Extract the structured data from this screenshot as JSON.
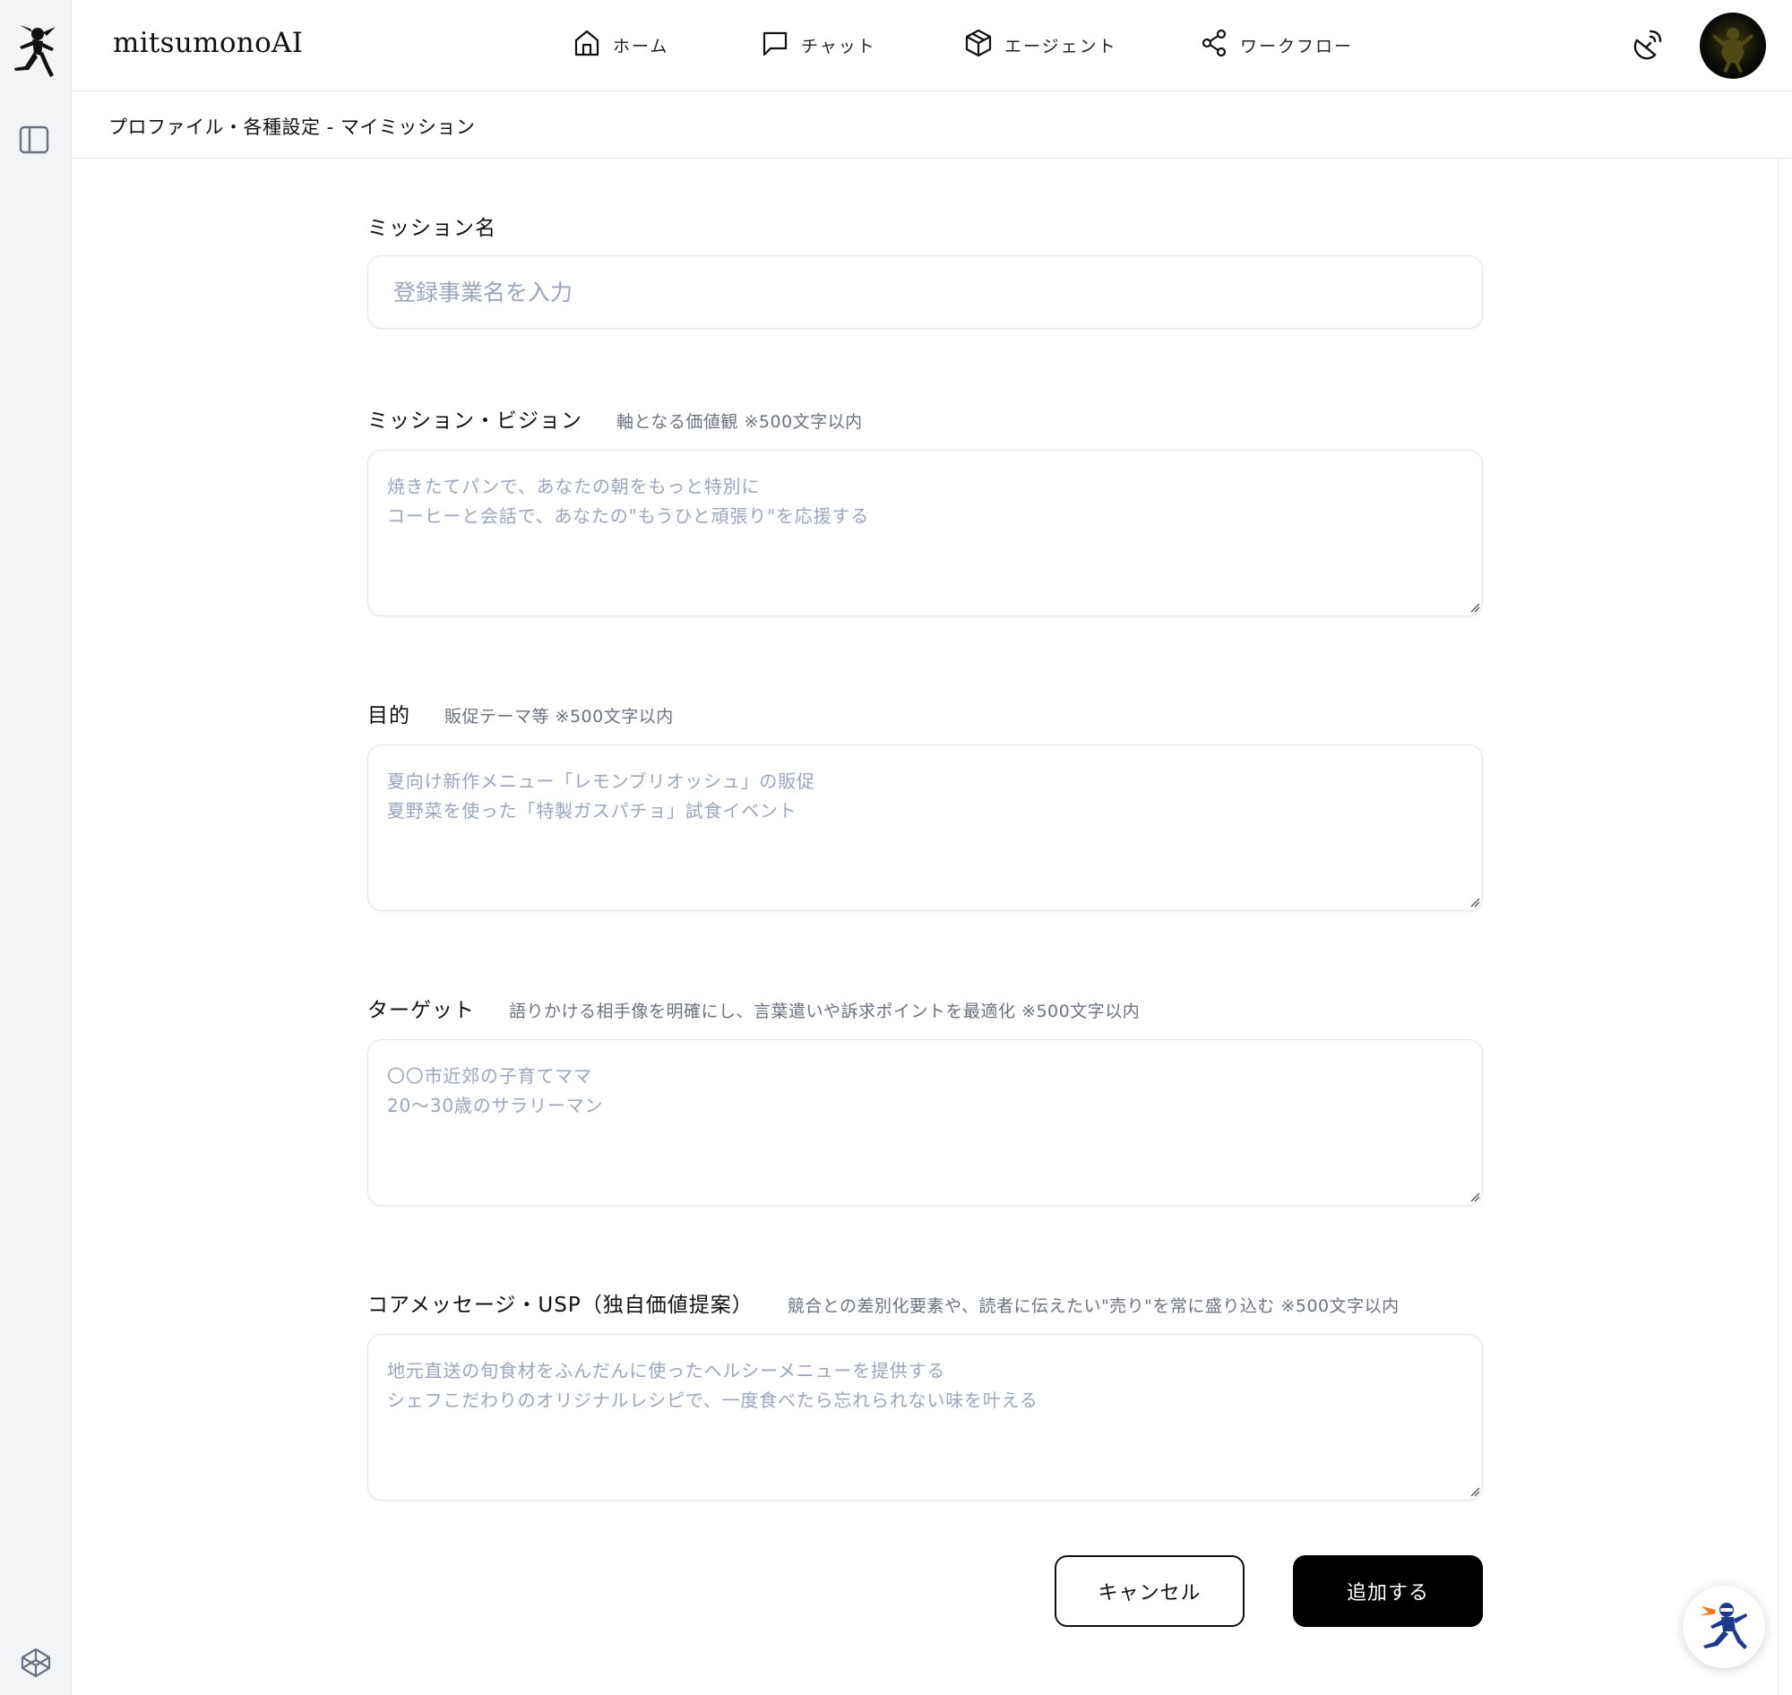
{
  "app": {
    "name": "mitsumonoAI"
  },
  "nav": {
    "items": [
      {
        "label": "ホーム",
        "icon": "home-icon"
      },
      {
        "label": "チャット",
        "icon": "chat-icon"
      },
      {
        "label": "エージェント",
        "icon": "box-icon"
      },
      {
        "label": "ワークフロー",
        "icon": "share-icon"
      }
    ]
  },
  "header_icons": [
    "satellite-icon",
    "avatar"
  ],
  "sidebar_icons": [
    "logo-ninja-icon",
    "panel-toggle-icon",
    "codepen-cube-icon"
  ],
  "breadcrumb": "プロファイル・各種設定 - マイミッション",
  "form": {
    "mission_name": {
      "label": "ミッション名",
      "value": "",
      "placeholder": "登録事業名を入力"
    },
    "vision": {
      "label": "ミッション・ビジョン",
      "hint": "軸となる価値観 ※500文字以内",
      "value": "",
      "placeholder": "焼きたてパンで、あなたの朝をもっと特別に\nコーヒーと会話で、あなたの\"もうひと頑張り\"を応援する"
    },
    "purpose": {
      "label": "目的",
      "hint": "販促テーマ等 ※500文字以内",
      "value": "",
      "placeholder": "夏向け新作メニュー「レモンブリオッシュ」の販促\n夏野菜を使った「特製ガスパチョ」試食イベント"
    },
    "target": {
      "label": "ターゲット",
      "hint": "語りかける相手像を明確にし、言葉遣いや訴求ポイントを最適化 ※500文字以内",
      "value": "",
      "placeholder": "〇〇市近郊の子育てママ\n20〜30歳のサラリーマン"
    },
    "usp": {
      "label": "コアメッセージ・USP（独自価値提案）",
      "hint": "競合との差別化要素や、読者に伝えたい\"売り\"を常に盛り込む ※500文字以内",
      "value": "",
      "placeholder": "地元直送の旬食材をふんだんに使ったヘルシーメニューを提供する\nシェフこだわりのオリジナルレシピで、一度食べたら忘れられない味を叶える"
    }
  },
  "actions": {
    "cancel": "キャンセル",
    "submit": "追加する"
  },
  "floating": {
    "icon": "ninja-help-icon"
  },
  "colors": {
    "primary": "#000000",
    "placeholder": "#9aa6bb",
    "border": "#e2e5ea",
    "rail": "#f3f4f6",
    "ninja_accent": "#f97316",
    "ninja_body": "#1e3a8a"
  }
}
